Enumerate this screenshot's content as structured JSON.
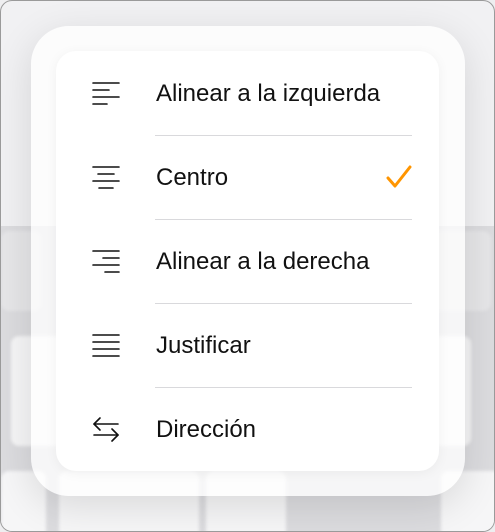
{
  "menu": {
    "items": [
      {
        "label": "Alinear a la izquierda",
        "icon": "align-left-icon",
        "selected": false
      },
      {
        "label": "Centro",
        "icon": "align-center-icon",
        "selected": true
      },
      {
        "label": "Alinear a la derecha",
        "icon": "align-right-icon",
        "selected": false
      },
      {
        "label": "Justificar",
        "icon": "justify-icon",
        "selected": false
      },
      {
        "label": "Dirección",
        "icon": "text-direction-icon",
        "selected": false
      }
    ]
  },
  "colors": {
    "checkmark": "#ff9500",
    "text": "#111111",
    "separator": "#d9d9dc"
  }
}
